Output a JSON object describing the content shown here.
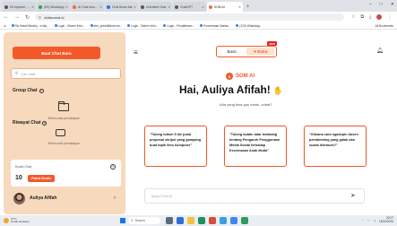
{
  "browser": {
    "tabs": [
      {
        "label": "Kit imperial - ...",
        "fav": "gr",
        "active": false
      },
      {
        "label": "(69) WhatsApp",
        "fav": "",
        "active": false
      },
      {
        "label": "AI Chat bisa ...",
        "fav": "or",
        "active": false
      },
      {
        "label": "Chat Aman bar...",
        "fav": "fb",
        "active": false
      },
      {
        "label": "Unlimited Char...",
        "fav": "gr",
        "active": false
      },
      {
        "label": "ChatGPT",
        "fav": "gr",
        "active": false
      },
      {
        "label": "SOM AI",
        "fav": "or",
        "active": true
      }
    ],
    "new_tab": "+",
    "url": "chatsomai.id",
    "bookmarks": [
      "Riz Ilmiah Biowhy - a kity...",
      "Login - Sistem Infor...",
      "ebe_preddiffame.sm...",
      "Login - Sistem Infor...",
      "Login - Pendaftaran...",
      "Penerimaan Mahas...",
      "(120) WhatsApp"
    ],
    "bookmarks_right": "All Bookmarks"
  },
  "sidebar": {
    "new_chat_label": "Buat Chat Baru",
    "search_placeholder": "Cari chat",
    "group_chat_title": "Group Chat",
    "group_chat_empty": "Belum ada percakapan",
    "history_title": "Riwayat Chat",
    "history_empty": "Belum ada percakapan",
    "quota_label": "Kuota Chat",
    "quota_value": "10",
    "quota_badge": "Paket Gratis",
    "user_name": "Auliya Afifah"
  },
  "header": {
    "mode_basic": "Basic",
    "mode_extra": "Extra",
    "mode_new_badge": "NEW"
  },
  "main": {
    "logo_text": "SOM AI",
    "logo_mark": "S",
    "greeting": "Hai, Auliya Afifah!",
    "subtitle": "Ada yang bisa gue bantu, sobat?",
    "prompt_cards": [
      "\"Tolong tulisin 5 ide judul proposal skripsi yang gampang buat topik ilmu komputer\"",
      "\"Tolong buatin latar belakang tentang Pengaruh Penggunaan Media Sosial terhadap Kecemasan Anak Muda\"",
      "\"Gimana cara ngadepin dosen pembimbing yang galak dan susah ditemuin?\""
    ],
    "input_placeholder": "Tanya SOM AI"
  },
  "taskbar": {
    "weather_temp": "27°C",
    "weather_desc": "Cerah berawan",
    "search_label": "Search",
    "clock_time": "20:07",
    "clock_date": "16/12/2024"
  },
  "colors": {
    "accent": "#f25a29",
    "sidebar_bg": "#f7d9bd"
  }
}
